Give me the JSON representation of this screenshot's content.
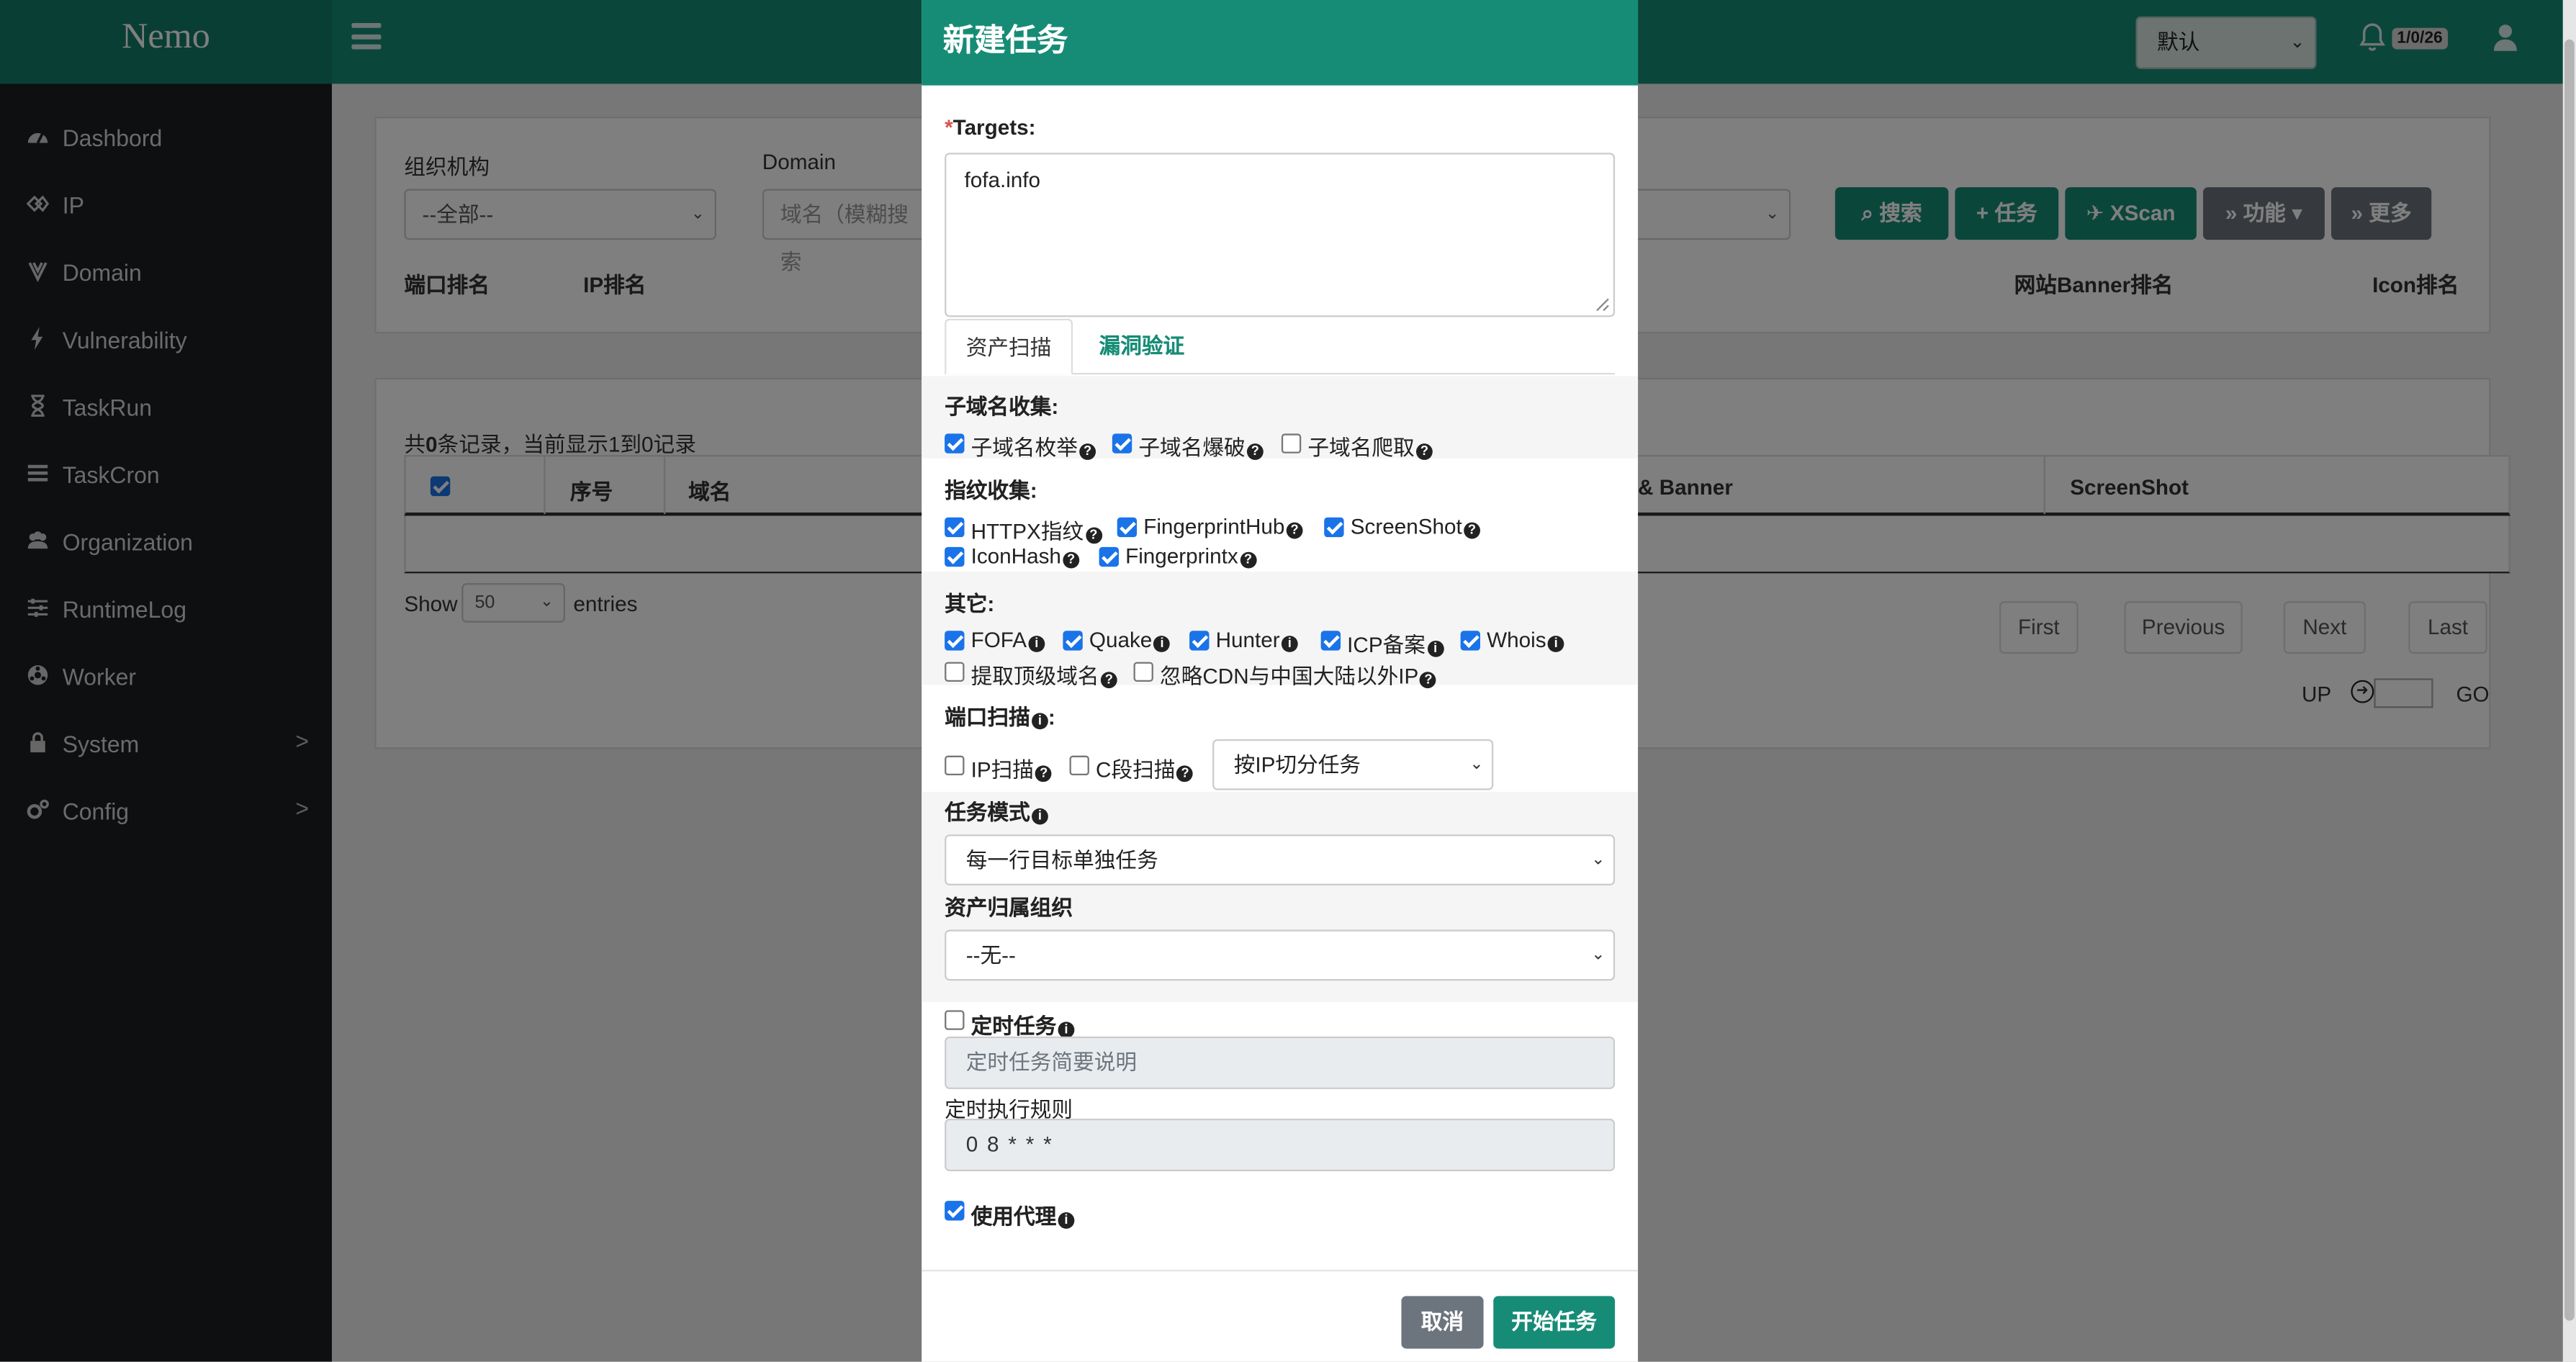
{
  "header": {
    "brand": "Nemo",
    "workspace": "默认",
    "notifications": "1/0/26"
  },
  "sidebar": {
    "items": [
      {
        "label": "Dashbord",
        "icon": "dashboard-icon"
      },
      {
        "label": "IP",
        "icon": "ip-icon"
      },
      {
        "label": "Domain",
        "icon": "domain-icon"
      },
      {
        "label": "Vulnerability",
        "icon": "bolt-icon"
      },
      {
        "label": "TaskRun",
        "icon": "hourglass-icon"
      },
      {
        "label": "TaskCron",
        "icon": "list-icon"
      },
      {
        "label": "Organization",
        "icon": "users-icon"
      },
      {
        "label": "RuntimeLog",
        "icon": "sliders-icon"
      },
      {
        "label": "Worker",
        "icon": "worker-icon"
      },
      {
        "label": "System",
        "icon": "lock-icon",
        "chevron": ">"
      },
      {
        "label": "Config",
        "icon": "gears-icon",
        "chevron": ">"
      }
    ]
  },
  "filters": {
    "org_label": "组织机构",
    "org_value": "--全部--",
    "domain_label": "Domain",
    "domain_placeholder": "域名（模糊搜索",
    "port_rank": "端口排名",
    "ip_rank": "IP排名",
    "banner_rank": "网站Banner排名",
    "icon_rank": "Icon排名"
  },
  "actions": {
    "search": "搜索",
    "task": "任务",
    "xscan": "XScan",
    "func": "功能",
    "more": "更多"
  },
  "table": {
    "summary_pre": "共",
    "summary_count": "0",
    "summary_post": "条记录，当前显示1到0记录",
    "columns": [
      "序号",
      "域名",
      "& Banner",
      "ScreenShot"
    ],
    "show": "Show",
    "page_size": "50",
    "entries": "entries",
    "pager": [
      "First",
      "Previous",
      "Next",
      "Last"
    ],
    "up": "UP",
    "go": "GO"
  },
  "modal": {
    "title": "新建任务",
    "required_mark": "*",
    "targets_label": "Targets:",
    "targets_value": "fofa.info",
    "tabs": [
      "资产扫描",
      "漏洞验证"
    ],
    "subdomain": {
      "title": "子域名收集:",
      "options": [
        {
          "label": "子域名枚举",
          "checked": true
        },
        {
          "label": "子域名爆破",
          "checked": true
        },
        {
          "label": "子域名爬取",
          "checked": false
        }
      ]
    },
    "fingerprint": {
      "title": "指纹收集:",
      "options": [
        {
          "label": "HTTPX指纹",
          "checked": true
        },
        {
          "label": "FingerprintHub",
          "checked": true
        },
        {
          "label": "ScreenShot",
          "checked": true
        },
        {
          "label": "IconHash",
          "checked": true
        },
        {
          "label": "Fingerprintx",
          "checked": true
        }
      ]
    },
    "other": {
      "title": "其它:",
      "options": [
        {
          "label": "FOFA",
          "checked": true
        },
        {
          "label": "Quake",
          "checked": true
        },
        {
          "label": "Hunter",
          "checked": true
        },
        {
          "label": "ICP备案",
          "checked": true
        },
        {
          "label": "Whois",
          "checked": true
        },
        {
          "label": "提取顶级域名",
          "checked": false
        },
        {
          "label": "忽略CDN与中国大陆以外IP",
          "checked": false
        }
      ]
    },
    "portscan": {
      "title": "端口扫描",
      "options": [
        {
          "label": "IP扫描",
          "checked": false
        },
        {
          "label": "C段扫描",
          "checked": false
        }
      ],
      "split": "按IP切分任务"
    },
    "mode_label": "任务模式",
    "mode_value": "每一行目标单独任务",
    "org_label": "资产归属组织",
    "org_value": "--无--",
    "cron_label": "定时任务",
    "cron_checked": false,
    "cron_placeholder": "定时任务简要说明",
    "cron_rule_label": "定时执行规则",
    "cron_rule_value": "0 8 * * *",
    "proxy_label": "使用代理",
    "proxy_checked": true,
    "cancel": "取消",
    "start": "开始任务"
  },
  "colors": {
    "accent": "#168c76",
    "sidebar": "#1a1f23",
    "checkbox": "#1a73e8",
    "cancel": "#6c757d"
  }
}
